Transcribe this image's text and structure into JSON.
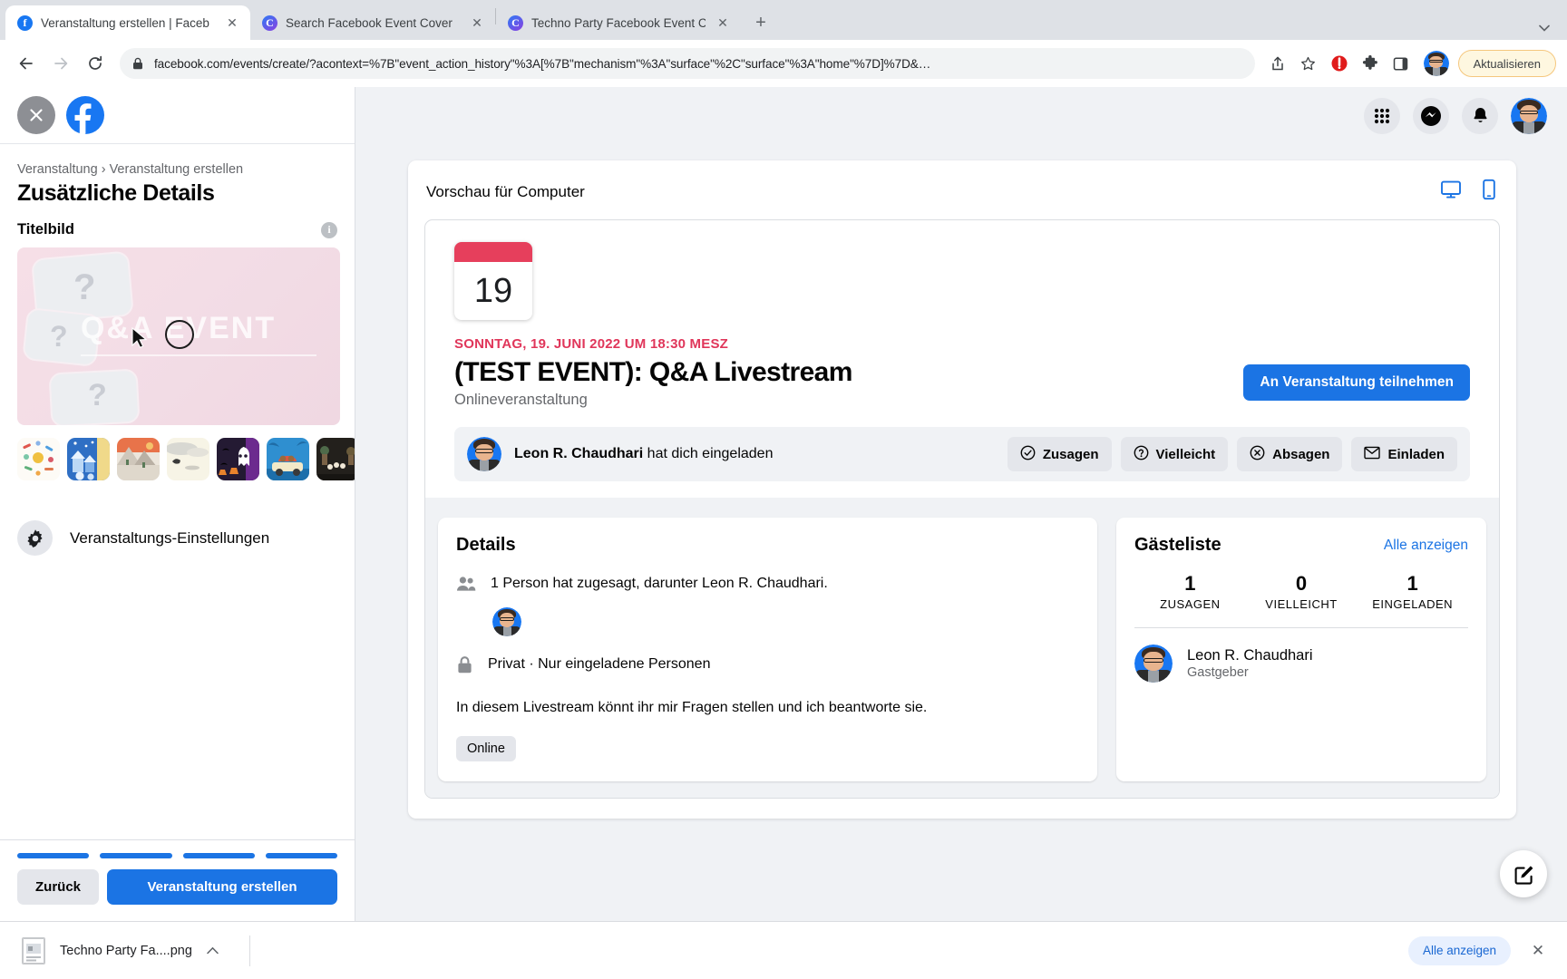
{
  "browser": {
    "tabs": [
      {
        "title": "Veranstaltung erstellen | Faceb",
        "icon": "facebook-favicon",
        "active": true
      },
      {
        "title": "Search Facebook Event Cover",
        "icon": "canva-favicon",
        "active": false
      },
      {
        "title": "Techno Party Facebook Event C",
        "icon": "canva-favicon",
        "active": false
      }
    ],
    "new_tab_label": "+",
    "tabstrip_chevron": "⌄",
    "back_icon": "←",
    "forward_icon": "→",
    "reload_icon": "↻",
    "lock_icon": "🔒",
    "url": "facebook.com/events/create/?acontext=%7B\"event_action_history\"%3A[%7B\"mechanism\"%3A\"surface\"%2C\"surface\"%3A\"home\"%7D]%7D&…",
    "share_icon": "share-icon",
    "bookmark_icon": "☆",
    "extension_icons": [
      "adblock-icon",
      "puzzle-icon",
      "sidepanel-icon"
    ],
    "update_button": "Aktualisieren"
  },
  "leftpanel": {
    "close_icon": "close-icon",
    "logo": "facebook-logo",
    "breadcrumb": "Veranstaltung › Veranstaltung erstellen",
    "title": "Zusätzliche Details",
    "cover_label": "Titelbild",
    "info_icon": "i",
    "cover_text": "Q&A EVENT",
    "thumbnails": [
      {
        "name": "celebration-confetti-thumb"
      },
      {
        "name": "winter-village-thumb"
      },
      {
        "name": "mountain-hike-thumb"
      },
      {
        "name": "beach-sand-thumb"
      },
      {
        "name": "halloween-ghost-thumb"
      },
      {
        "name": "road-trip-thumb"
      },
      {
        "name": "night-party-thumb"
      }
    ],
    "settings_label": "Veranstaltungs-Einstellungen",
    "progress_steps": 4,
    "back_button": "Zurück",
    "create_button": "Veranstaltung erstellen"
  },
  "topbar": {
    "menu_icon": "grid-menu-icon",
    "messenger_icon": "messenger-icon",
    "notifications_icon": "bell-icon",
    "avatar": "user-avatar"
  },
  "preview": {
    "title": "Vorschau für Computer",
    "desktop_icon": "desktop-icon",
    "mobile_icon": "mobile-icon",
    "calendar_day": "19",
    "date_line": "SONNTAG, 19. JUNI 2022 UM 18:30 MESZ",
    "event_title": "(TEST EVENT): Q&A Livestream",
    "event_subtitle": "Onlineveranstaltung",
    "join_button": "An Veranstaltung teilnehmen",
    "invite": {
      "host": "Leon R. Chaudhari",
      "text": " hat dich eingeladen",
      "buttons": [
        {
          "label": "Zusagen",
          "icon": "check-circle-icon"
        },
        {
          "label": "Vielleicht",
          "icon": "question-circle-icon"
        },
        {
          "label": "Absagen",
          "icon": "x-circle-icon"
        },
        {
          "label": "Einladen",
          "icon": "envelope-icon"
        }
      ]
    },
    "details": {
      "title": "Details",
      "attendees_icon": "people-icon",
      "attendees_text": "1 Person hat zugesagt, darunter Leon R. Chaudhari.",
      "attendee_avatar": "attendee-avatar",
      "privacy_icon": "lock-icon",
      "privacy_text": "Privat · Nur eingeladene Personen",
      "description": "In diesem Livestream könnt ihr mir Fragen stellen und ich beantworte sie.",
      "chip": "Online"
    },
    "guests": {
      "title": "Gästeliste",
      "show_all": "Alle anzeigen",
      "stats": [
        {
          "value": "1",
          "label": "ZUSAGEN"
        },
        {
          "value": "0",
          "label": "VIELLEICHT"
        },
        {
          "value": "1",
          "label": "EINGELADEN"
        }
      ],
      "people": [
        {
          "name": "Leon R. Chaudhari",
          "role": "Gastgeber"
        }
      ]
    },
    "fab_icon": "edit-pencil-icon"
  },
  "downloadbar": {
    "file_icon": "png-file-icon",
    "file_name": "Techno Party Fa....png",
    "chevron": "∧",
    "show_all": "Alle anzeigen",
    "close_icon": "✕"
  },
  "colors": {
    "fb_blue": "#1b74e4",
    "date_red": "#e0365a",
    "panel_bg": "#f0f2f5"
  }
}
